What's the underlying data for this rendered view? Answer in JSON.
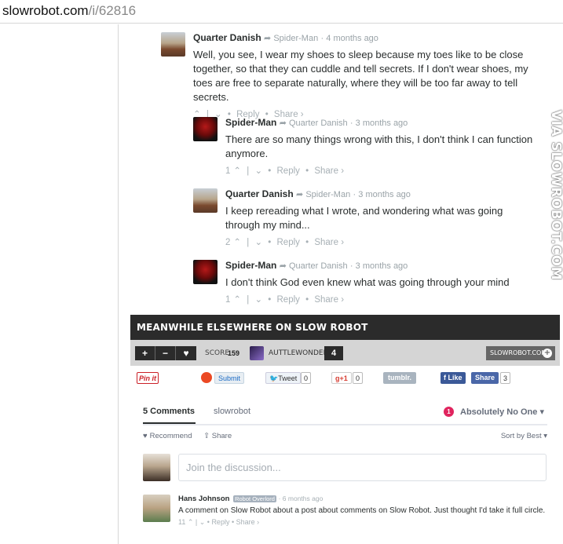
{
  "url": {
    "host": "slowrobot.com",
    "path": "/i/62816"
  },
  "watermark": "VIA SLOWROBOT.COM",
  "thread": [
    {
      "author": "Quarter Danish",
      "reply_to": "Spider-Man",
      "time": "4 months ago",
      "text": "Well, you see, I wear my shoes to sleep because my toes like to be close together, so that they can cuddle and tell secrets. If I don't wear shoes, my toes are free to separate naturally, where they will be too far away to tell secrets.",
      "votes": "",
      "reply": "Reply",
      "share": "Share ›"
    },
    {
      "author": "Spider-Man",
      "reply_to": "Quarter Danish",
      "time": "3 months ago",
      "text": "There are so many things wrong with this, I don't think I can function anymore.",
      "votes": "1",
      "reply": "Reply",
      "share": "Share ›"
    },
    {
      "author": "Quarter Danish",
      "reply_to": "Spider-Man",
      "time": "3 months ago",
      "text": "I keep rereading what I wrote, and wondering what was going through my mind...",
      "votes": "2",
      "reply": "Reply",
      "share": "Share ›"
    },
    {
      "author": "Spider-Man",
      "reply_to": "Quarter Danish",
      "time": "3 months ago",
      "text": "I don't think God even knew what was going through your mind",
      "votes": "1",
      "reply": "Reply",
      "share": "Share ›"
    }
  ],
  "banner": {
    "title": "MEANWHILE ELSEWHERE ON SLOW ROBOT"
  },
  "toolbar": {
    "plus": "+",
    "minus": "−",
    "heart": "♥",
    "score_label": "SCORE",
    "score": "159",
    "username": "AUTTLEWONDER",
    "user_count": "4",
    "site_button": "SLOWROBOT.COM",
    "site_plus": "+"
  },
  "share": {
    "pinterest": "Pin it",
    "stumble": "Submit",
    "tweet": "Tweet",
    "tweet_count": "0",
    "gplus": "g+1",
    "gplus_count": "0",
    "tumblr": "tumblr.",
    "fb_like": "Like",
    "fb_share": "Share",
    "fb_count": "3"
  },
  "disqus": {
    "tab_comments": "5 Comments",
    "tab_site": "slowrobot",
    "notif_count": "1",
    "user": "Absolutely No One ▾",
    "recommend": "Recommend",
    "share": "Share",
    "sort": "Sort by Best ▾",
    "placeholder": "Join the discussion...",
    "comment": {
      "author": "Hans Johnson",
      "badge": "Robot Overlord",
      "time": "6 months ago",
      "text": "A comment on Slow Robot about a post about comments on Slow Robot. Just thought I'd take it full circle.",
      "votes": "11",
      "reply": "Reply",
      "share": "Share ›"
    }
  }
}
